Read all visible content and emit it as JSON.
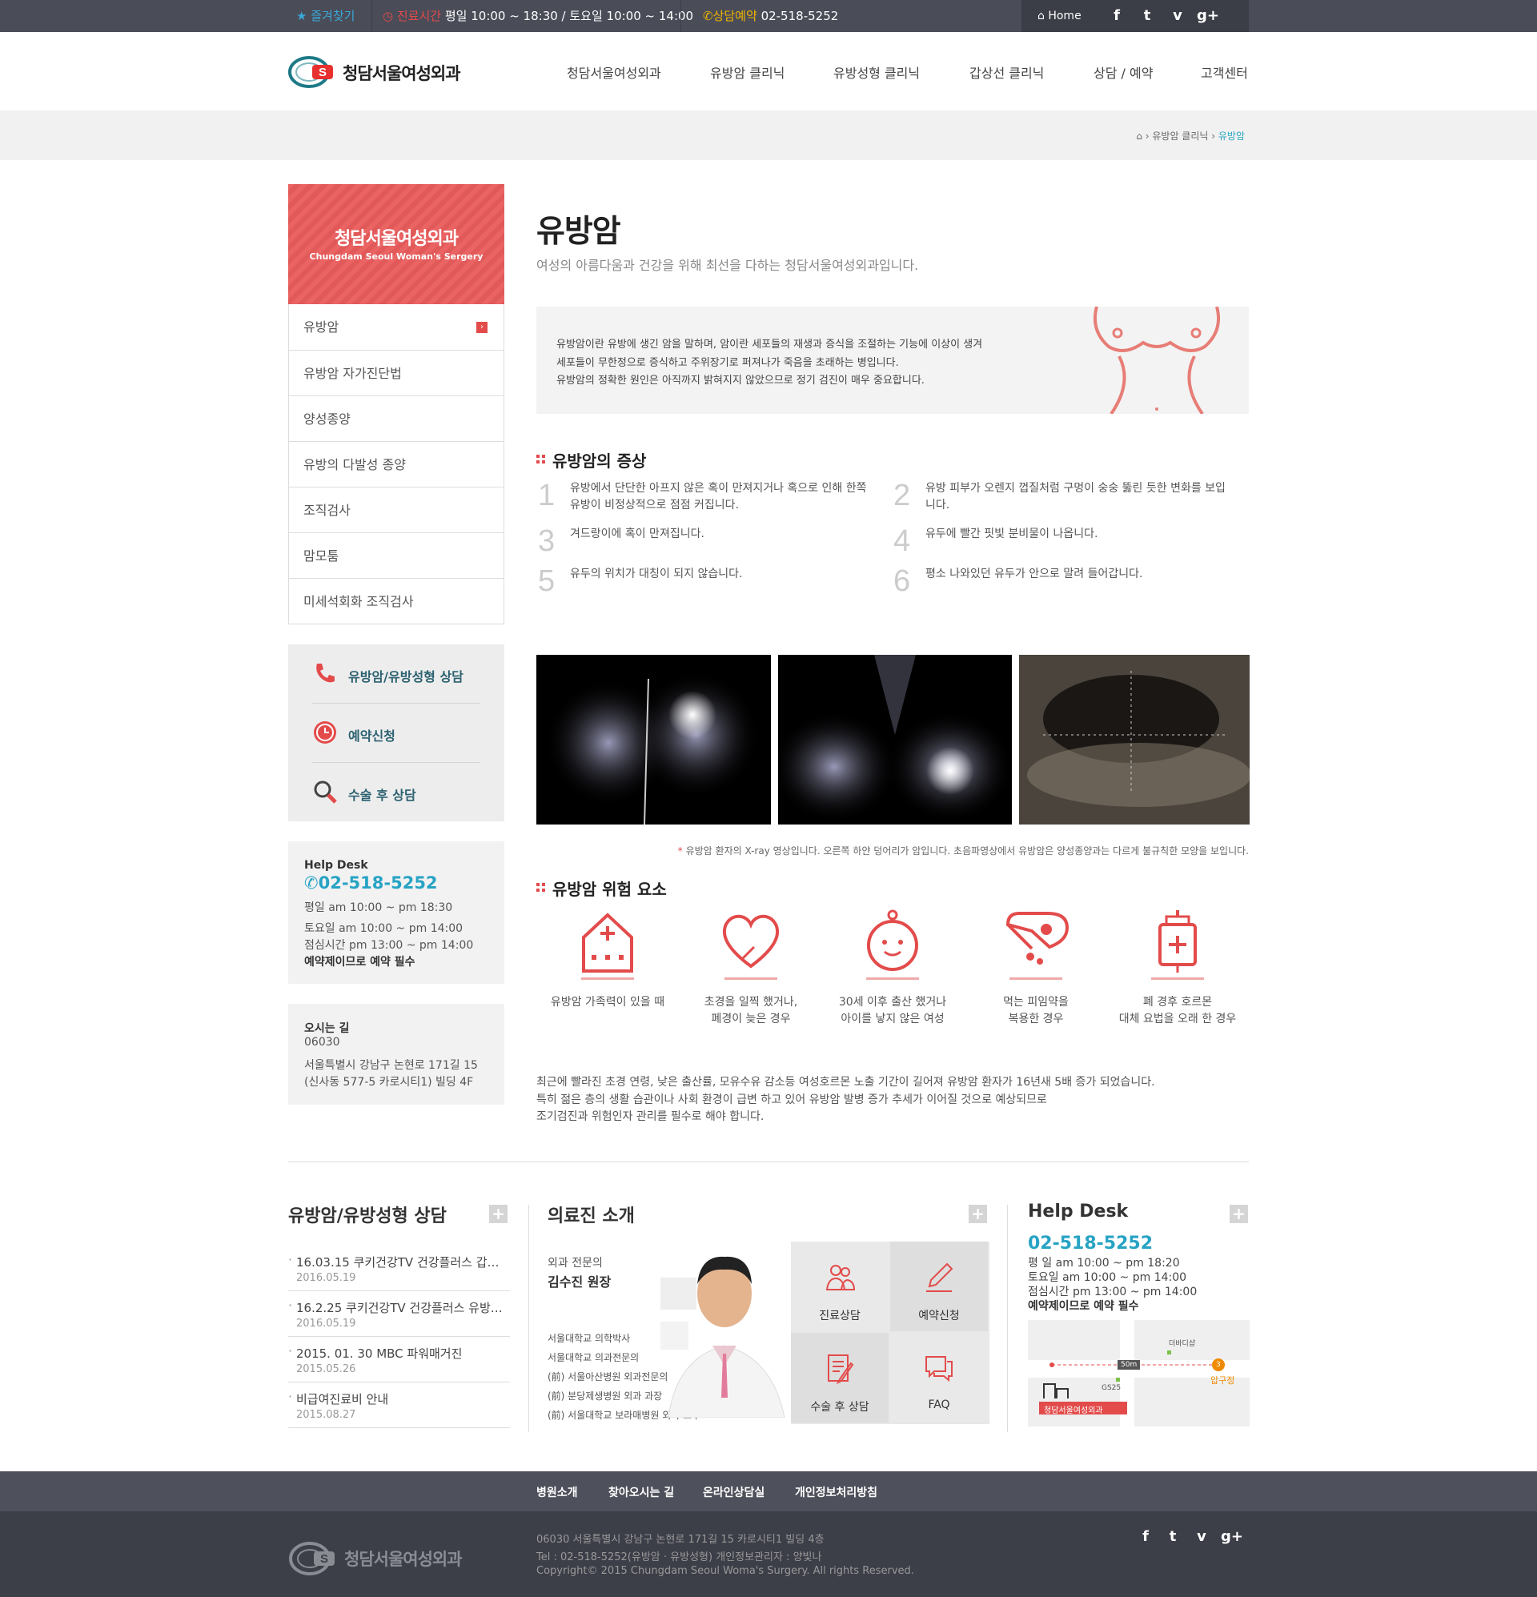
{
  "topbar": {
    "favorite": "즐겨찾기",
    "hours_label": "진료시간",
    "hours_value": "평일 10:00 ~ 18:30 / 토요일 10:00 ~ 14:00",
    "reserve_label": "상담예약",
    "reserve_phone": "02-518-5252",
    "home": "Home"
  },
  "header": {
    "logo_text": "청담서울여성외과",
    "nav": [
      "청담서울여성외과",
      "유방암 클리닉",
      "유방성형 클리닉",
      "갑상선 클리닉",
      "상담 / 예약",
      "고객센터"
    ]
  },
  "breadcrumb": {
    "items": [
      "유방암 클리닉",
      "유방암"
    ]
  },
  "sidebar": {
    "title": "청담서울여성외과",
    "subtitle": "Chungdam Seoul Woman's Sergery",
    "items": [
      "유방암",
      "유방암 자가진단법",
      "양성종양",
      "유방의 다발성 종양",
      "조직검사",
      "맘모툼",
      "미세석회화 조직검사"
    ],
    "quick": [
      "유방암/유방성형 상담",
      "예약신청",
      "수술 후 상담"
    ],
    "helpdesk": {
      "label": "Help Desk",
      "phone": "02-518-5252",
      "lines": [
        "평일 am 10:00 ~ pm 18:30",
        "토요일 am 10:00 ~ pm 14:00",
        "점심시간 pm 13:00 ~ pm 14:00",
        "예약제이므로 예약 필수"
      ]
    },
    "address": {
      "label": "오시는 길",
      "lines": [
        "06030",
        "서울특별시 강남구 논현로 171길 15",
        "(신사동 577-5 카로시티1) 빌딩 4F"
      ]
    }
  },
  "main": {
    "title": "유방암",
    "subtitle": "여성의 아름다움과 건강을 위해 최선을 다하는 청담서울여성외과입니다.",
    "intro": [
      "유방암이란 유방에 생긴 암을 말하며, 암이란 세포들의 재생과 증식을 조절하는 기능에 이상이 생겨",
      "세포들이 무한정으로 증식하고 주위장기로 퍼져나가 죽음을 초래하는 병입니다.",
      "유방암의 정확한 원인은 아직까지 밝혀지지 않았으므로 정기 검진이 매우 중요합니다."
    ],
    "symptoms_title": "유방암의 증상",
    "symptoms": [
      {
        "num": "1",
        "text": "유방에서 단단한 아프지 않은 혹이 만져지거나 혹으로 인해 한쪽 유방이 비정상적으로 점점 커집니다."
      },
      {
        "num": "2",
        "text": "유방 피부가 오렌지 껍질처럼 구멍이 숭숭 뚫린 듯한 변화를 보입니다."
      },
      {
        "num": "3",
        "text": "겨드랑이에 혹이 만져집니다."
      },
      {
        "num": "4",
        "text": "유두에 빨간 핏빛 분비물이 나옵니다."
      },
      {
        "num": "5",
        "text": "유두의 위치가 대칭이 되지 않습니다."
      },
      {
        "num": "6",
        "text": "평소 나와있던 유두가 안으로 말려 들어갑니다."
      }
    ],
    "caption": "유방암 환자의 X-ray 영상입니다. 오른쪽 하얀 덩어리가 암입니다. 초음파영상에서 유방암은 양성종양과는 다르게 불규칙한 모양을 보입니다.",
    "risk_title": "유방암 위험 요소",
    "risks": [
      [
        "유방암 가족력이 있을 때"
      ],
      [
        "초경을 일찍 했거나,",
        "폐경이 늦은 경우"
      ],
      [
        "30세 이후 출산 했거나",
        "아이를 낳지 않은 여성"
      ],
      [
        "먹는 피임약을",
        "복용한 경우"
      ],
      [
        "폐 경후 호르몬",
        "대체 요법을 오래 한 경우"
      ]
    ],
    "paragraph": [
      "최근에 빨라진 초경 연령, 낮은 출산률, 모유수유 감소등 여성호르몬 노출 기간이 길어져 유방암 환자가 16년새 5배 증가 되었습니다.",
      "특히 젊은 층의 생활 습관이나 사회 환경이 급변 하고 있어 유방암 발병 증가 추세가 이어질 것으로 예상되므로",
      "조기검진과 위험인자 관리를 필수로 해야 합니다."
    ]
  },
  "bottom": {
    "news_title": "유방암/유방성형 상담",
    "news": [
      {
        "title": "16.03.15 쿠키건강TV 건강플러스 갑…",
        "date": "2016.05.19"
      },
      {
        "title": "16.2.25 쿠키건강TV 건강플러스 유방…",
        "date": "2016.05.19"
      },
      {
        "title": "2015. 01. 30 MBC 파워매거진",
        "date": "2015.05.26"
      },
      {
        "title": "비급여진료비 안내",
        "date": "2015.08.27"
      }
    ],
    "doctor_title": "의료진 소개",
    "doctor_role": "외과 전문의",
    "doctor_name": "김수진 원장",
    "doctor_career": [
      "서울대학교 의학박사",
      "서울대학교 의과전문의",
      "(前) 서울아산병원 외과전문의",
      "(前) 분당제생병원 외과 과장",
      "(前) 서울대학교 보라매병원 외과 교수"
    ],
    "tiles": [
      "진료상담",
      "예약신청",
      "수술 후 상담",
      "FAQ"
    ],
    "helpdesk_title": "Help Desk",
    "helpdesk_phone": "02-518-5252",
    "helpdesk_lines": [
      "평 일   am 10:00 ~ pm 18:20",
      "토요일   am 10:00 ~ pm 14:00",
      "점심시간   pm 13:00 ~ pm 14:00",
      "예약제이므로 예약 필수"
    ],
    "map": {
      "place1": "더바디샵",
      "distance": "50m",
      "station": "압구정",
      "station_num": "3",
      "gs": "GS25",
      "clinic": "청담서울여성외과"
    }
  },
  "footer": {
    "nav": [
      "병원소개",
      "찾아오시는 길",
      "온라인상담실",
      "개인정보처리방침"
    ],
    "logo_text": "청담서울여성외과",
    "lines": [
      "06030 서울특별시 강남구 논현로 171길 15 카로시티1 빌딩 4층",
      "Tel : 02-518-5252(유방암 · 유방성형)      개인정보관리자 : 양빛나",
      "Copyright© 2015 Chungdam Seoul Woma's Surgery. All rights Reserved."
    ]
  },
  "colors": {
    "accent_red": "#e34b4b",
    "accent_blue": "#27a3c4",
    "topbar": "#4a4c58",
    "footer": "#3c3e48"
  }
}
